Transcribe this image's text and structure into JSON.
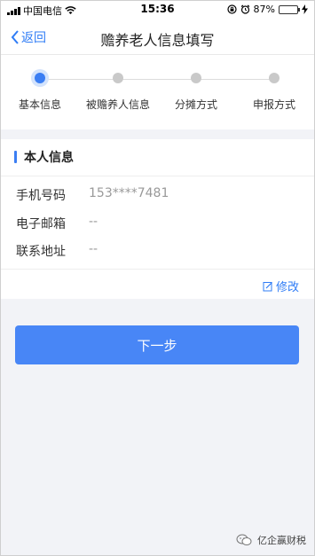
{
  "status_bar": {
    "carrier": "中国电信",
    "time": "15:36",
    "battery_percent": "87%",
    "battery_level": 0.87
  },
  "nav": {
    "back_label": "返回",
    "title": "赡养老人信息填写"
  },
  "steps": [
    {
      "label": "基本信息",
      "active": true
    },
    {
      "label": "被赡养人信息",
      "active": false
    },
    {
      "label": "分摊方式",
      "active": false
    },
    {
      "label": "申报方式",
      "active": false
    }
  ],
  "personal_info": {
    "section_title": "本人信息",
    "fields": [
      {
        "label": "手机号码",
        "value": "153****7481"
      },
      {
        "label": "电子邮箱",
        "value": "--"
      },
      {
        "label": "联系地址",
        "value": "--"
      }
    ],
    "edit_label": "修改"
  },
  "actions": {
    "next_label": "下一步"
  },
  "watermark": {
    "text": "亿企赢财税"
  },
  "colors": {
    "accent": "#3b7ef3",
    "button": "#4886f6",
    "background": "#f2f3f7"
  }
}
